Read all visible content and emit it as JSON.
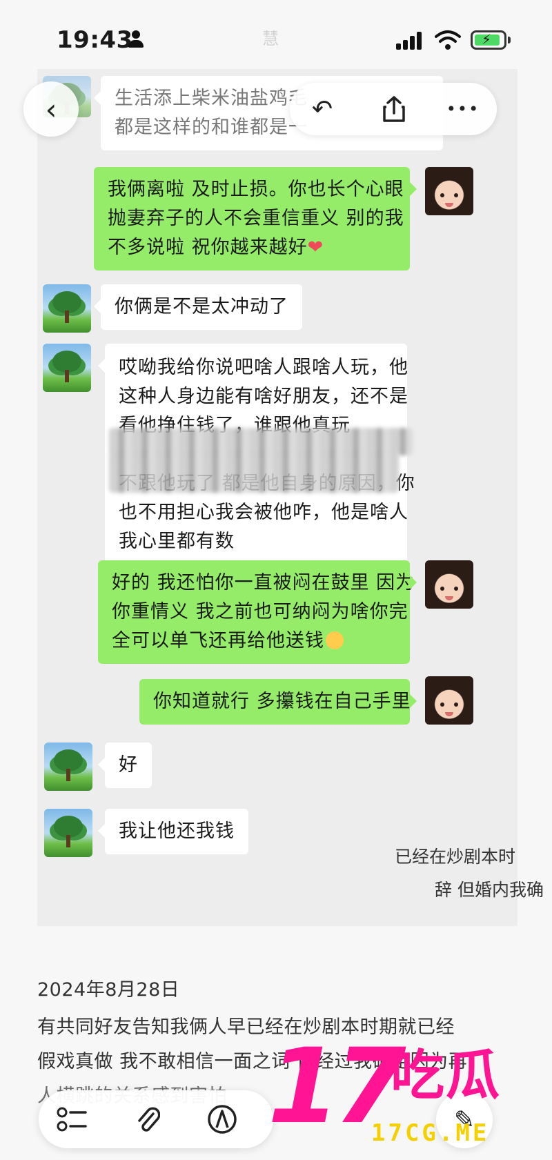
{
  "status_bar": {
    "time": "19:43",
    "center_text": "慧",
    "icons": [
      "person-icon",
      "signal-icon",
      "wifi-icon",
      "battery-charging-icon"
    ]
  },
  "top_controls": {
    "back_icon": "‹",
    "undo_icon": "↶",
    "share_icon": "⇪",
    "more_icon": "•••"
  },
  "chat": {
    "messages": [
      {
        "side": "in",
        "lines": [
          "生活添上柴米油盐鸡毛",
          "都是这样的和谁都是一"
        ]
      },
      {
        "side": "out",
        "lines": [
          "我俩离啦 及时止损。你也长个心眼",
          "抛妻弃子的人不会重信重义 别的我",
          "不多说啦 祝你越来越好"
        ],
        "emoji": "❤"
      },
      {
        "side": "in",
        "lines": [
          "你俩是不是太冲动了"
        ]
      },
      {
        "side": "in",
        "lines": [
          "哎呦我给你说吧啥人跟啥人玩，他",
          "这种人身边能有啥好朋友，还不是",
          "看他挣住钱了，谁跟他真玩",
          "",
          "不跟他玩了 都是他自身的原因，你",
          "也不用担心我会被他咋，他是啥人",
          "我心里都有数"
        ]
      },
      {
        "side": "out",
        "lines": [
          "好的 我还怕你一直被闷在鼓里 因为",
          "你重情义 我之前也可纳闷为啥你完",
          "全可以单飞还再给他送钱"
        ]
      },
      {
        "side": "out",
        "lines": [
          "你知道就行 多攥钱在自己手里"
        ]
      },
      {
        "side": "in",
        "lines": [
          "好"
        ]
      },
      {
        "side": "in",
        "lines": [
          "我让他还我钱"
        ]
      }
    ]
  },
  "side_note": {
    "lines": [
      "已经在炒剧本时",
      "辞 但婚内我确"
    ]
  },
  "article": {
    "date": "2024年8月28日",
    "lines": [
      "有共同好友告知我俩人早已经在炒剧本时期就已经",
      "假戏真做 我不敢相信一面之词 但经过我确定因为再",
      "人横跳的关系感到害怕"
    ]
  },
  "toolbar": {
    "checklist_icon": "☰",
    "attach_icon": "📎",
    "markup_icon": "Ⓐ",
    "edit_icon": "✎"
  },
  "watermark": {
    "number": "17",
    "chinese": "吃瓜",
    "url": "17CG.ME"
  }
}
